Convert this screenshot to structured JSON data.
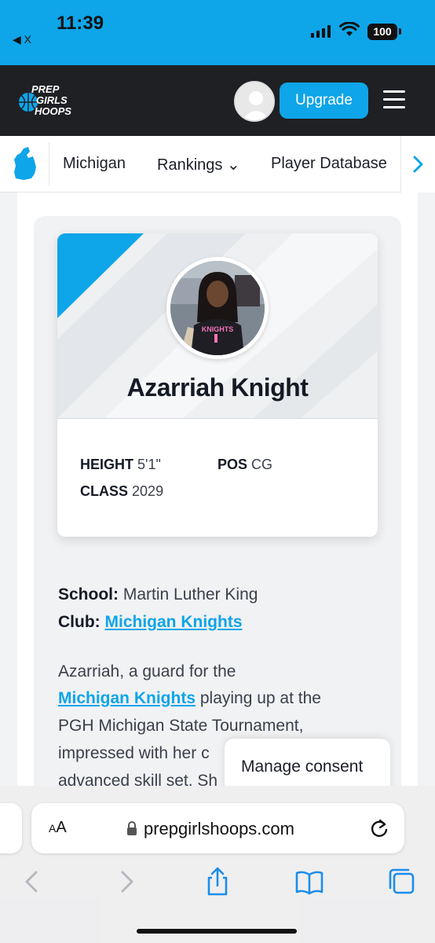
{
  "status_bar": {
    "time": "11:39",
    "back_app": "◀ X",
    "battery": "100"
  },
  "header": {
    "logo": {
      "line1": "PREP",
      "line2": "GIRLS",
      "line3": "HOOPS"
    },
    "upgrade_label": "Upgrade"
  },
  "subnav": {
    "items": [
      {
        "label": "Michigan"
      },
      {
        "label": "Rankings ⌄"
      },
      {
        "label": "Player Database"
      }
    ]
  },
  "player": {
    "name": "Azarriah Knight",
    "stats": {
      "height_label": "HEIGHT",
      "height_value": "5'1\"",
      "pos_label": "POS",
      "pos_value": "CG",
      "class_label": "CLASS",
      "class_value": "2029"
    },
    "jersey": "KNIGHTS"
  },
  "bio": {
    "school_label": "School:",
    "school_value": "Martin Luther King",
    "club_label": "Club:",
    "club_value": "Michigan Knights",
    "p1": "Azarriah, a guard for the",
    "p2_link": "Michigan Knights",
    "p2_rest": "playing up at the",
    "p3": "PGH Michigan State Tournament,",
    "p4": "impressed with her c",
    "p5": "advanced skill set. Sh"
  },
  "consent": {
    "label": "Manage consent"
  },
  "safari": {
    "aa_small": "A",
    "aa_big": "A",
    "url": "prepgirlshoops.com"
  },
  "colors": {
    "brand": "#0ea5e9",
    "header_bg": "#1e2023"
  }
}
